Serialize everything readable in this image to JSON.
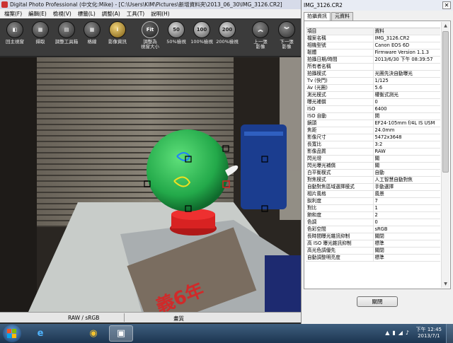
{
  "app": {
    "title": "Digital Photo Professional (中文化:Mike) - [C:\\Users\\KIM\\Pictures\\新增資料夾\\2013_06_30\\IMG_3126.CR2]",
    "menu": [
      "檔案(F)",
      "編輯(E)",
      "檢視(V)",
      "標籤(L)",
      "調整(A)",
      "工具(T)",
      "說明(H)"
    ]
  },
  "toolbar": [
    {
      "label": "回主視窗",
      "glyph": "◧"
    },
    {
      "label": "擷取",
      "glyph": "▦"
    },
    {
      "label": "調整工具箱",
      "glyph": "▤"
    },
    {
      "label": "格線",
      "glyph": "▦"
    },
    {
      "label": "影像資訊",
      "glyph": "i"
    },
    {
      "label": "調整為\n視窗大小",
      "glyph": "Fit"
    },
    {
      "label": "50%檢視",
      "glyph": "50"
    },
    {
      "label": "100%檢視",
      "glyph": "100"
    },
    {
      "label": "200%檢視",
      "glyph": "200"
    },
    {
      "label": "上一張\n影像",
      "glyph": "︽"
    },
    {
      "label": "下一張\n影像",
      "glyph": "︾"
    }
  ],
  "status": {
    "color_space": "RAW / sRGB",
    "quality": "畫質"
  },
  "info_panel": {
    "title": "IMG_3126.CR2",
    "close_glyph": "✕",
    "tabs": [
      "拍攝資訊",
      "元資料"
    ],
    "header": {
      "key": "項目",
      "value": "資料"
    },
    "rows": [
      {
        "key": "檔案名稱",
        "value": "IMG_3126.CR2"
      },
      {
        "key": "相機型號",
        "value": "Canon EOS 6D"
      },
      {
        "key": "韌體",
        "value": "Firmware Version 1.1.3"
      },
      {
        "key": "拍攝日期/時間",
        "value": "2013/6/30 下午 08:39:57"
      },
      {
        "key": "所有者名稱",
        "value": ""
      },
      {
        "key": "拍攝模式",
        "value": "光圈先決自動曝光"
      },
      {
        "key": "Tv (快門)",
        "value": "1/125"
      },
      {
        "key": "Av (光圈)",
        "value": "5.6"
      },
      {
        "key": "測光模式",
        "value": "權衡式測光"
      },
      {
        "key": "曝光補償",
        "value": "0"
      },
      {
        "key": "ISO",
        "value": "6400"
      },
      {
        "key": "ISO 自動",
        "value": "開"
      },
      {
        "key": "鏡頭",
        "value": "EF24-105mm f/4L IS USM"
      },
      {
        "key": "焦距",
        "value": "24.0mm"
      },
      {
        "key": "影像尺寸",
        "value": "5472x3648"
      },
      {
        "key": "長寬比",
        "value": "3:2"
      },
      {
        "key": "影像品質",
        "value": "RAW"
      },
      {
        "key": "閃光燈",
        "value": "關"
      },
      {
        "key": "閃光曝光補償",
        "value": "關"
      },
      {
        "key": "白平衡模式",
        "value": "自動"
      },
      {
        "key": "對焦模式",
        "value": "人工智慧自動對焦"
      },
      {
        "key": "自動對焦區域選擇模式",
        "value": "手動選擇"
      },
      {
        "key": "相片風格",
        "value": "風景"
      },
      {
        "key": "銳利度",
        "value": "7"
      },
      {
        "key": "對比",
        "value": "1"
      },
      {
        "key": "飽和度",
        "value": "2"
      },
      {
        "key": "色調",
        "value": "0"
      },
      {
        "key": "色彩空間",
        "value": "sRGB"
      },
      {
        "key": "長時間曝光雜訊抑制",
        "value": "關閉"
      },
      {
        "key": "高 ISO 曝光雜訊抑制",
        "value": "標準"
      },
      {
        "key": "高光色調優先",
        "value": "關閉"
      },
      {
        "key": "自動調整明亮度",
        "value": "標準"
      }
    ],
    "close_button": "關閉"
  },
  "taskbar": {
    "apps": [
      {
        "name": "internet-explorer",
        "glyph": "e"
      },
      {
        "name": "chrome",
        "glyph": "◉"
      },
      {
        "name": "digital-photo-professional",
        "glyph": "▣"
      }
    ],
    "time": "下午 12:45",
    "date": "2013/7/1"
  },
  "colors": {
    "toolbar_bg": "#3b3b3b",
    "panel_bg": "#f0f0f0",
    "taskbar_bg": "#1c3550",
    "af_point_active": "#e02020"
  }
}
